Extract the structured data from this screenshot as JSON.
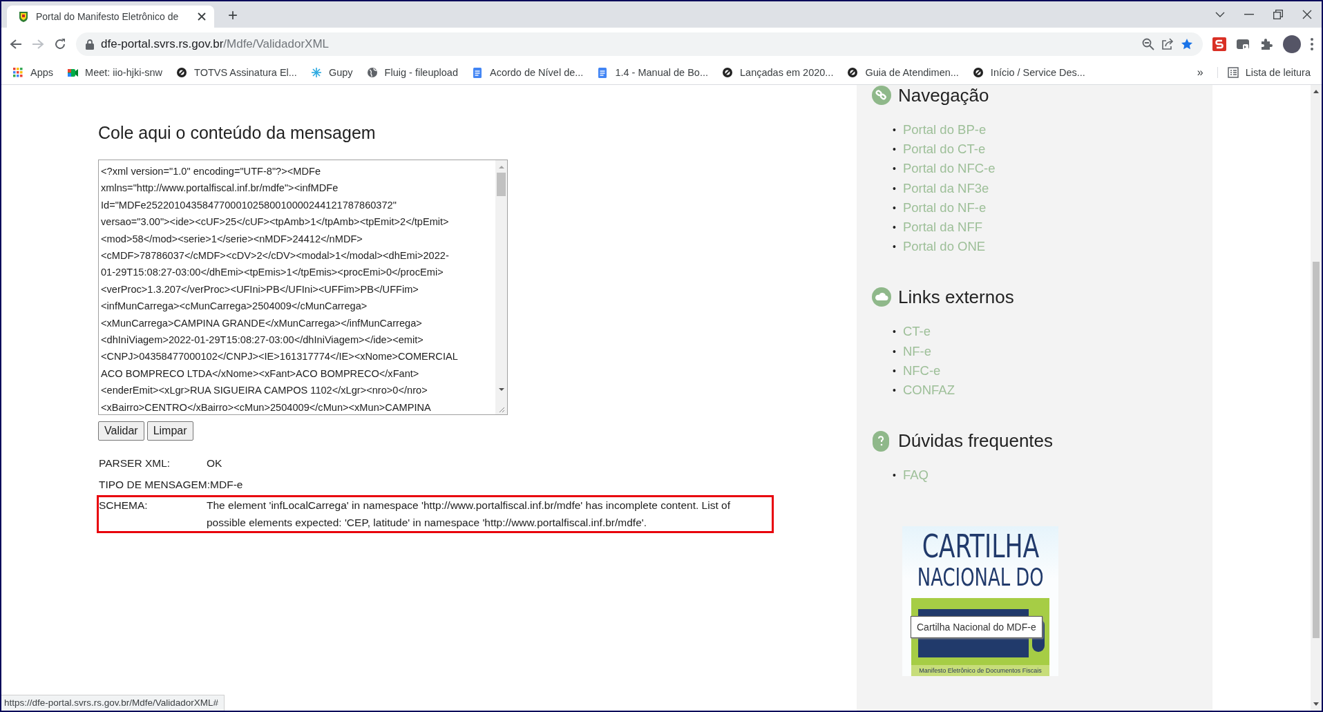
{
  "browser": {
    "tab": {
      "title": "Portal do Manifesto Eletrônico de",
      "selected": true
    },
    "new_tab": "+",
    "address": {
      "host": "dfe-portal.svrs.rs.gov.br",
      "path": "/Mdfe/ValidadorXML"
    },
    "bookmarks": [
      {
        "label": "Apps",
        "kind": "apps"
      },
      {
        "label": "Meet: iio-hjki-snw",
        "kind": "meet"
      },
      {
        "label": "TOTVS Assinatura El...",
        "kind": "ring"
      },
      {
        "label": "Gupy",
        "kind": "snowflake"
      },
      {
        "label": "Fluig - fileupload",
        "kind": "globe"
      },
      {
        "label": "Acordo de Nível de...",
        "kind": "doc"
      },
      {
        "label": "1.4 - Manual de Bo...",
        "kind": "doc"
      },
      {
        "label": "Lançadas em 2020...",
        "kind": "ring"
      },
      {
        "label": "Guia de Atendimen...",
        "kind": "ring"
      },
      {
        "label": "Início / Service Des...",
        "kind": "ring"
      }
    ],
    "overflow": "»",
    "reading_list": "Lista de leitura"
  },
  "page": {
    "heading": "Cole aqui o conteúdo da mensagem",
    "xml_lines": [
      "<?xml version=\"1.0\" encoding=\"UTF-8\"?><MDFe",
      "xmlns=\"http://www.portalfiscal.inf.br/mdfe\"><infMDFe",
      "Id=\"MDFe25220104358477000102580010000244121787860372\"",
      "versao=\"3.00\"><ide><cUF>25</cUF><tpAmb>1</tpAmb><tpEmit>2</tpEmit>",
      "<mod>58</mod><serie>1</serie><nMDF>24412</nMDF>",
      "<cMDF>78786037</cMDF><cDV>2</cDV><modal>1</modal><dhEmi>2022-",
      "01-29T15:08:27-03:00</dhEmi><tpEmis>1</tpEmis><procEmi>0</procEmi>",
      "<verProc>1.3.207</verProc><UFIni>PB</UFIni><UFFim>PB</UFFim>",
      "<infMunCarrega><cMunCarrega>2504009</cMunCarrega>",
      "<xMunCarrega>CAMPINA GRANDE</xMunCarrega></infMunCarrega>",
      "<dhIniViagem>2022-01-29T15:08:27-03:00</dhIniViagem></ide><emit>",
      "<CNPJ>04358477000102</CNPJ><IE>161317774</IE><xNome>COMERCIAL",
      "ACO BOMPRECO LTDA</xNome><xFant>ACO BOMPRECO</xFant>",
      "<enderEmit><xLgr>RUA SIGUEIRA CAMPOS 1102</xLgr><nro>0</nro>",
      "<xBairro>CENTRO</xBairro><cMun>2504009</cMun><xMun>CAMPINA"
    ],
    "buttons": [
      "Validar",
      "Limpar"
    ],
    "results": [
      {
        "label": "PARSER XML:",
        "value": "OK",
        "highlighted": false
      },
      {
        "label": "TIPO DE MENSAGEM:",
        "value": "MDF-e",
        "highlighted": false
      },
      {
        "label": "SCHEMA:",
        "value": "The element 'infLocalCarrega' in namespace 'http://www.portalfiscal.inf.br/mdfe' has incomplete content. List of possible elements expected: 'CEP, latitude' in namespace 'http://www.portalfiscal.inf.br/mdfe'.",
        "highlighted": true
      }
    ]
  },
  "sidebar": {
    "sections": [
      {
        "title": "Navegação",
        "kind": "link",
        "links": [
          {
            "marker": "•",
            "label": "Portal do BP-e"
          },
          {
            "marker": "•",
            "label": "Portal do CT-e"
          },
          {
            "marker": "•",
            "label": "Portal do NFC-e"
          },
          {
            "marker": "•",
            "label": "Portal da NF3e"
          },
          {
            "marker": "•",
            "label": "Portal do NF-e"
          },
          {
            "marker": "•",
            "label": "Portal da NFF"
          },
          {
            "marker": "•",
            "label": "Portal do ONE"
          }
        ]
      },
      {
        "title": "Links externos",
        "kind": "cloud",
        "links": [
          {
            "marker": "•",
            "label": "CT-e"
          },
          {
            "marker": "•",
            "label": "NF-e"
          },
          {
            "marker": "•",
            "label": "NFC-e"
          },
          {
            "marker": "•",
            "label": "CONFAZ"
          }
        ]
      },
      {
        "title": "Dúvidas frequentes",
        "kind": "question",
        "links": [
          {
            "marker": "•",
            "label": "FAQ"
          }
        ]
      }
    ],
    "banner": {
      "line_1": "CARTILHA",
      "line_2": "NACIONAL DO",
      "caption": "Manifesto Eletrônico de Documentos Fiscais"
    },
    "tooltip": "Cartilha Nacional do MDF-e"
  },
  "status_url": "https://dfe-portal.svrs.rs.gov.br/Mdfe/ValidadorXML#"
}
